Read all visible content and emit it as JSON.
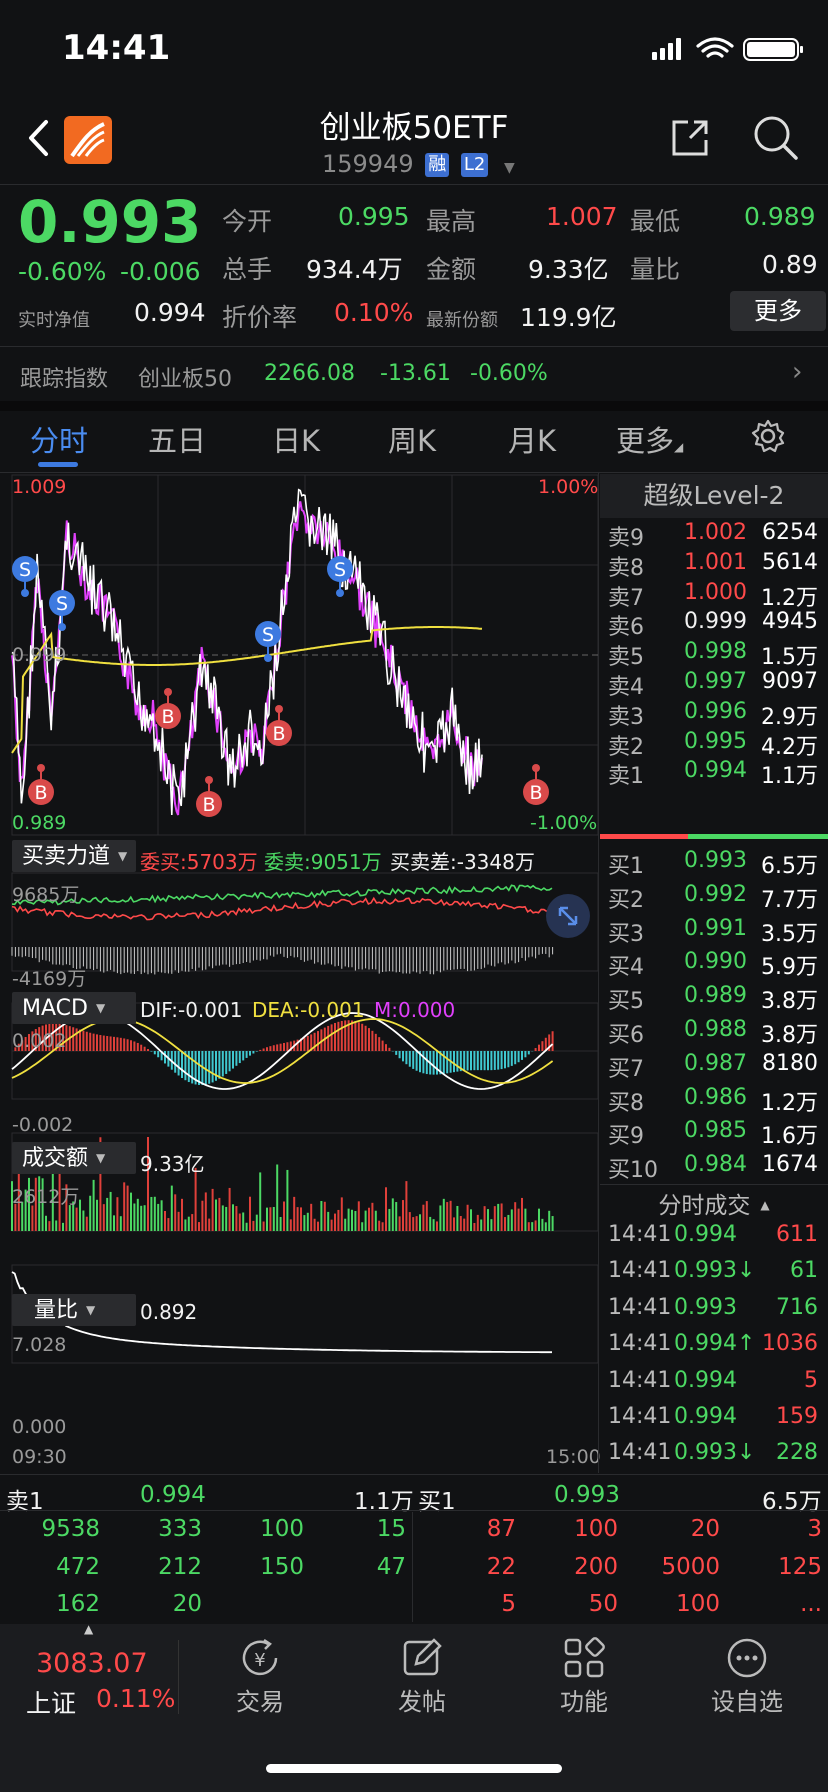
{
  "status": {
    "time": "14:41"
  },
  "header": {
    "title": "创业板50ETF",
    "code": "159949",
    "tag_margin": "融",
    "tag_level": "L2"
  },
  "quote": {
    "price": "0.993",
    "change_pct": "-0.60%",
    "change": "-0.006",
    "nav_label": "实时净值",
    "nav_value": "0.994",
    "open_label": "今开",
    "open": "0.995",
    "high_label": "最高",
    "high": "1.007",
    "low_label": "最低",
    "low": "0.989",
    "volume_label": "总手",
    "volume": "934.4万",
    "amount_label": "金额",
    "amount": "9.33亿",
    "vol_ratio_label": "量比",
    "vol_ratio": "0.89",
    "discount_label": "折价率",
    "discount": "0.10%",
    "shares_label": "最新份额",
    "shares": "119.9亿",
    "more_button": "更多"
  },
  "tracking": {
    "label": "跟踪指数",
    "index_name": "创业板50",
    "value": "2266.08",
    "change": "-13.61",
    "change_pct": "-0.60%"
  },
  "tabs": [
    "分时",
    "五日",
    "日K",
    "周K",
    "月K",
    "更多"
  ],
  "intraday": {
    "top_left": "1.009",
    "top_right": "1.00%",
    "bottom_left": "0.989",
    "bottom_right": "-1.00%",
    "mid_label": "0.999",
    "time_start": "09:30",
    "time_end": "15:00",
    "markers": [
      "S",
      "S",
      "S",
      "S",
      "B",
      "B",
      "B",
      "B",
      "B"
    ]
  },
  "power": {
    "title": "买卖力道",
    "buy_label": "委买:5703万",
    "sell_label": "委卖:9051万",
    "diff_label": "买卖差:-3348万",
    "top": "9685万",
    "bottom": "-4169万"
  },
  "macd": {
    "title": "MACD",
    "dif": "DIF:-0.001",
    "dea": "DEA:-0.001",
    "m": "M:0.000",
    "top": "0.002",
    "bottom": "-0.002"
  },
  "turnover": {
    "title": "成交额",
    "value": "9.33亿",
    "top": "2612万"
  },
  "ratio": {
    "title": "量比",
    "value": "0.892",
    "top": "7.028",
    "bottom": "0.000"
  },
  "orderbook": {
    "title": "超级Level-2",
    "asks": [
      {
        "label": "卖9",
        "price": "1.002",
        "vol": "6254",
        "color": "red"
      },
      {
        "label": "卖8",
        "price": "1.001",
        "vol": "5614",
        "color": "red"
      },
      {
        "label": "卖7",
        "price": "1.000",
        "vol": "1.2万",
        "color": "red"
      },
      {
        "label": "卖6",
        "price": "0.999",
        "vol": "4945",
        "color": "white"
      },
      {
        "label": "卖5",
        "price": "0.998",
        "vol": "1.5万",
        "color": "green"
      },
      {
        "label": "卖4",
        "price": "0.997",
        "vol": "9097",
        "color": "green"
      },
      {
        "label": "卖3",
        "price": "0.996",
        "vol": "2.9万",
        "color": "green"
      },
      {
        "label": "卖2",
        "price": "0.995",
        "vol": "4.2万",
        "color": "green"
      },
      {
        "label": "卖1",
        "price": "0.994",
        "vol": "1.1万",
        "color": "green"
      }
    ],
    "bids": [
      {
        "label": "买1",
        "price": "0.993",
        "vol": "6.5万",
        "color": "green"
      },
      {
        "label": "买2",
        "price": "0.992",
        "vol": "7.7万",
        "color": "green"
      },
      {
        "label": "买3",
        "price": "0.991",
        "vol": "3.5万",
        "color": "green"
      },
      {
        "label": "买4",
        "price": "0.990",
        "vol": "5.9万",
        "color": "green"
      },
      {
        "label": "买5",
        "price": "0.989",
        "vol": "3.8万",
        "color": "green"
      },
      {
        "label": "买6",
        "price": "0.988",
        "vol": "3.8万",
        "color": "green"
      },
      {
        "label": "买7",
        "price": "0.987",
        "vol": "8180",
        "color": "green"
      },
      {
        "label": "买8",
        "price": "0.986",
        "vol": "1.2万",
        "color": "green"
      },
      {
        "label": "买9",
        "price": "0.985",
        "vol": "1.6万",
        "color": "green"
      },
      {
        "label": "买10",
        "price": "0.984",
        "vol": "1674",
        "color": "green"
      }
    ]
  },
  "trades": {
    "title": "分时成交",
    "rows": [
      {
        "time": "14:41",
        "price": "0.994",
        "vol": "611",
        "dir": "",
        "vc": "red"
      },
      {
        "time": "14:41",
        "price": "0.993↓",
        "vol": "61",
        "dir": "",
        "vc": "green"
      },
      {
        "time": "14:41",
        "price": "0.993",
        "vol": "716",
        "dir": "",
        "vc": "green"
      },
      {
        "time": "14:41",
        "price": "0.994↑",
        "vol": "1036",
        "dir": "",
        "vc": "red"
      },
      {
        "time": "14:41",
        "price": "0.994",
        "vol": "5",
        "dir": "",
        "vc": "red"
      },
      {
        "time": "14:41",
        "price": "0.994",
        "vol": "159",
        "dir": "",
        "vc": "red"
      },
      {
        "time": "14:41",
        "price": "0.993↓",
        "vol": "228",
        "dir": "",
        "vc": "green"
      }
    ]
  },
  "queue": {
    "sell_label": "卖1",
    "sell_price": "0.994",
    "sell_vol": "1.1万",
    "buy_label": "买1",
    "buy_price": "0.993",
    "buy_vol": "6.5万",
    "sell_rows": [
      [
        "9538",
        "333",
        "100",
        "15"
      ],
      [
        "472",
        "212",
        "150",
        "47"
      ],
      [
        "162",
        "20",
        "",
        ""
      ]
    ],
    "buy_rows": [
      [
        "87",
        "100",
        "20",
        "3"
      ],
      [
        "22",
        "200",
        "5000",
        "125"
      ],
      [
        "5",
        "50",
        "100",
        "..."
      ]
    ]
  },
  "nav": {
    "index_value": "3083.07",
    "index_name": "上证",
    "index_pct": "0.11%",
    "items": [
      "交易",
      "发帖",
      "功能",
      "设自选"
    ]
  }
}
